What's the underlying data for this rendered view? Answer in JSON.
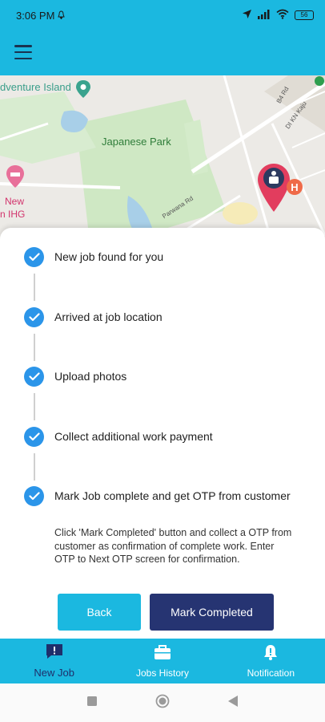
{
  "status_bar": {
    "time": "3:06 PM",
    "battery": "56"
  },
  "map": {
    "places": [
      "dventure Island",
      "Japanese Park",
      "New",
      "n IHG"
    ],
    "roads": [
      "Parwana Rd",
      "B4 Rd",
      "DI KN Kaju"
    ]
  },
  "steps": [
    {
      "label": "New job found for you"
    },
    {
      "label": "Arrived at job location"
    },
    {
      "label": "Upload photos"
    },
    {
      "label": "Collect additional work payment"
    },
    {
      "label": "Mark Job complete and get OTP from customer"
    }
  ],
  "note": "Click 'Mark Completed' button and collect a OTP from customer as confirmation of complete work. Enter OTP to Next OTP screen for confirmation.",
  "buttons": {
    "back": "Back",
    "mark_completed": "Mark Completed"
  },
  "bottom_nav": {
    "new_job": "New Job",
    "jobs_history": "Jobs History",
    "notification": "Notification"
  },
  "colors": {
    "primary": "#1bb8e0",
    "dark": "#263472",
    "check": "#2b95e9"
  }
}
